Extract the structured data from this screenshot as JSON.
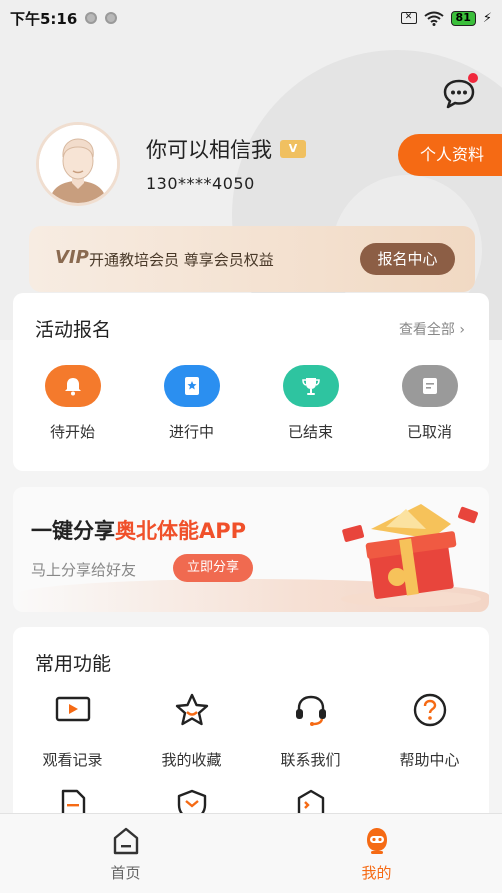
{
  "status_bar": {
    "time": "下午5:16",
    "battery": "81"
  },
  "profile": {
    "username": "你可以相信我",
    "vip_badge": "V",
    "phone": "130****4050",
    "profile_button": "个人资料"
  },
  "vip_bar": {
    "logo": "VIP",
    "text": "开通教培会员 尊享会员权益",
    "button": "报名中心"
  },
  "activity": {
    "title": "活动报名",
    "see_all": "查看全部 ›",
    "items": [
      {
        "label": "待开始",
        "icon": "bell-icon",
        "color": "#f47a2c"
      },
      {
        "label": "进行中",
        "icon": "star-bookmark-icon",
        "color": "#2b8ff0"
      },
      {
        "label": "已结束",
        "icon": "trophy-icon",
        "color": "#2ec4a0"
      },
      {
        "label": "已取消",
        "icon": "document-icon",
        "color": "#9a9a9a"
      }
    ]
  },
  "share_banner": {
    "title_prefix": "一键分享",
    "title_highlight": "奥北体能APP",
    "subtitle": "马上分享给好友",
    "button": "立即分享"
  },
  "functions": {
    "title": "常用功能",
    "items": [
      {
        "label": "观看记录",
        "icon": "play-icon"
      },
      {
        "label": "我的收藏",
        "icon": "star-icon"
      },
      {
        "label": "联系我们",
        "icon": "headset-icon"
      },
      {
        "label": "帮助中心",
        "icon": "help-icon"
      },
      {
        "label": "",
        "icon": "document-icon"
      },
      {
        "label": "",
        "icon": "shield-icon"
      },
      {
        "label": "",
        "icon": "face-icon"
      }
    ]
  },
  "bottom_nav": {
    "items": [
      {
        "label": "首页",
        "icon": "home-icon",
        "active": false
      },
      {
        "label": "我的",
        "icon": "robot-icon",
        "active": true
      }
    ],
    "active_color": "#f56a14",
    "inactive_color": "#666666"
  }
}
